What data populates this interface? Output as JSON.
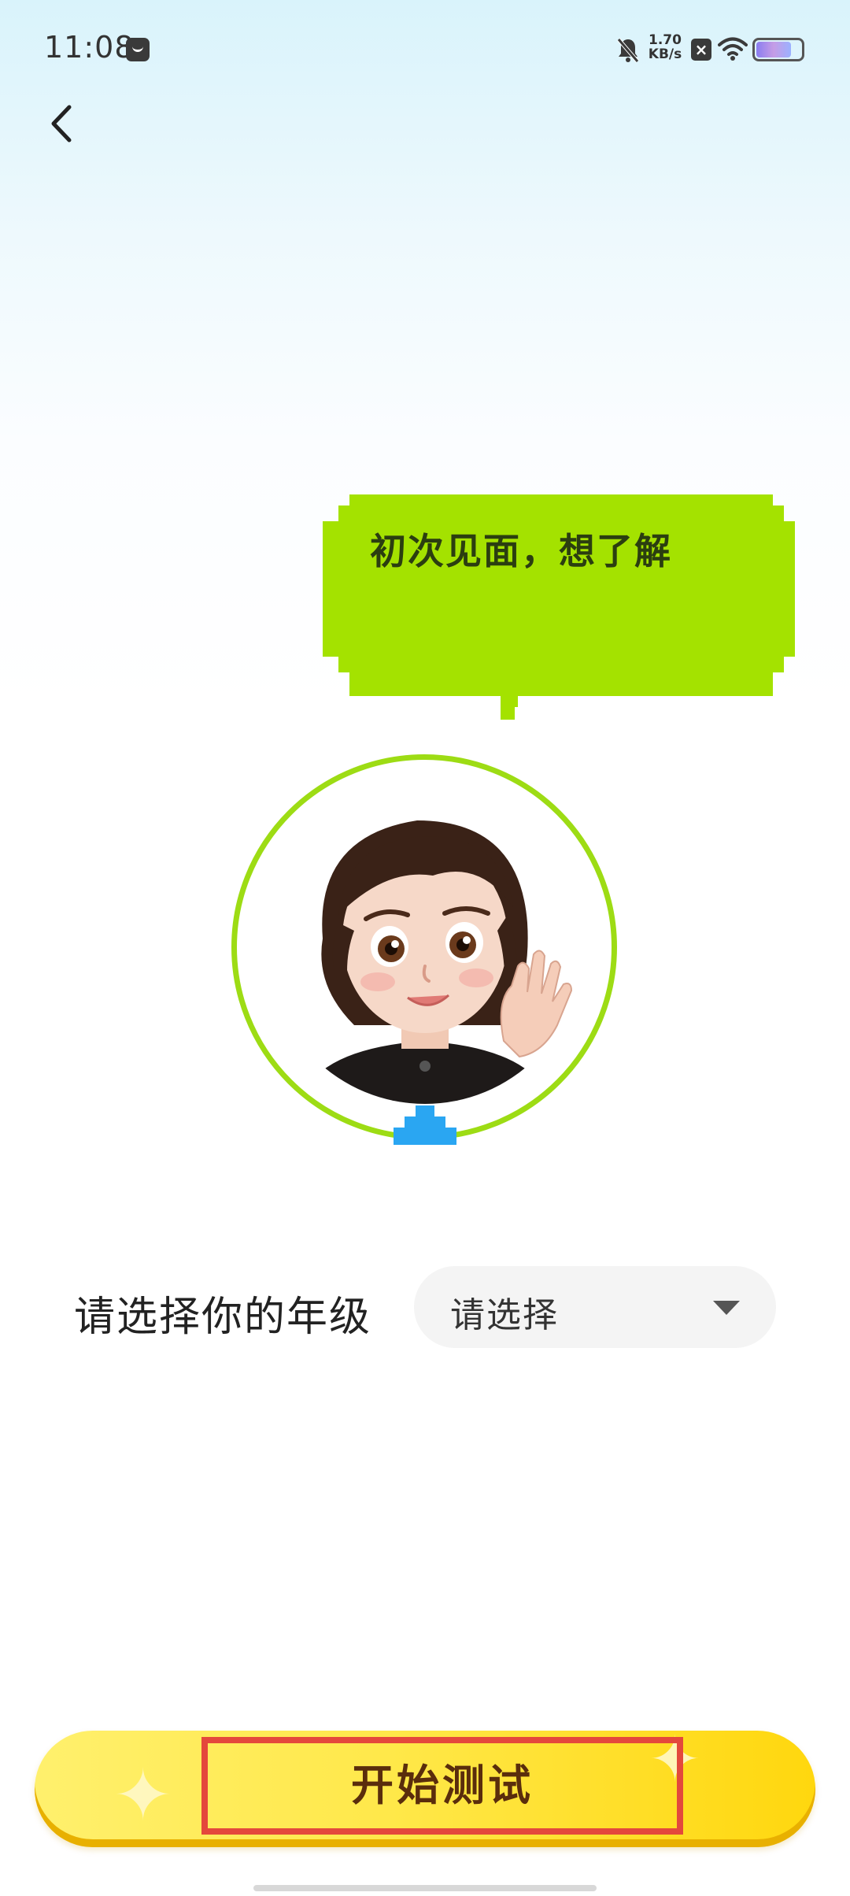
{
  "status_bar": {
    "time": "11:08",
    "network_speed_value": "1.70",
    "network_speed_unit": "KB/s",
    "battery_level": 0.8,
    "icons": [
      "app-notification-icon",
      "mute-icon",
      "close-box-icon",
      "wifi-icon",
      "battery-icon"
    ]
  },
  "nav": {
    "back_icon": "chevron-left-icon"
  },
  "speech_bubble": {
    "text": "初次见面，想了解"
  },
  "grade_selector": {
    "label": "请选择你的年级",
    "placeholder": "请选择",
    "arrow_icon": "caret-down-icon"
  },
  "start_button": {
    "label": "开始测试"
  },
  "colors": {
    "bubble": "#a4e200",
    "ring": "#9ddc14",
    "tab": "#2aa6f2",
    "button": "#ffe23a",
    "highlight": "#e4483c"
  }
}
